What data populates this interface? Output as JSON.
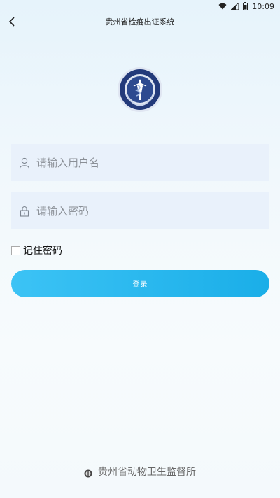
{
  "status_bar": {
    "time": "10:09"
  },
  "header": {
    "title": "贵州省检疫出证系统"
  },
  "form": {
    "username_placeholder": "请输入用户名",
    "password_placeholder": "请输入密码",
    "remember_label": "记住密码",
    "login_label": "登录"
  },
  "footer": {
    "org_name": "贵州省动物卫生监督所"
  },
  "colors": {
    "accent": "#1aaee8",
    "field_bg": "#e9f1fb"
  }
}
